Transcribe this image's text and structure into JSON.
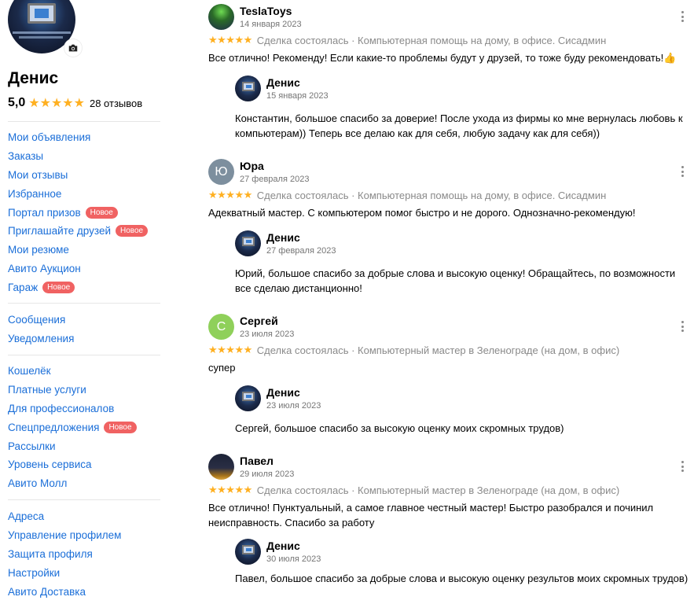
{
  "profile": {
    "name": "Денис",
    "rating": "5,0",
    "stars": "★★★★★",
    "reviews_count": "28 отзывов",
    "camera_icon": "camera-icon"
  },
  "menu_groups": [
    [
      {
        "label": "Мои объявления"
      },
      {
        "label": "Заказы"
      },
      {
        "label": "Мои отзывы"
      },
      {
        "label": "Избранное"
      },
      {
        "label": "Портал призов",
        "badge": "Новое"
      },
      {
        "label": "Приглашайте друзей",
        "badge": "Новое"
      },
      {
        "label": "Мои резюме"
      },
      {
        "label": "Авито Аукцион"
      },
      {
        "label": "Гараж",
        "badge": "Новое"
      }
    ],
    [
      {
        "label": "Сообщения"
      },
      {
        "label": "Уведомления"
      }
    ],
    [
      {
        "label": "Кошелёк"
      },
      {
        "label": "Платные услуги"
      },
      {
        "label": "Для профессионалов"
      },
      {
        "label": "Спецпредложения",
        "badge": "Новое"
      },
      {
        "label": "Рассылки"
      },
      {
        "label": "Уровень сервиса"
      },
      {
        "label": "Авито Молл"
      }
    ],
    [
      {
        "label": "Адреса"
      },
      {
        "label": "Управление профилем"
      },
      {
        "label": "Защита профиля"
      },
      {
        "label": "Настройки"
      },
      {
        "label": "Авито Доставка"
      }
    ]
  ],
  "colors": {
    "link": "#1a6ed8",
    "star": "#ffb021",
    "badge": "#f06262",
    "muted": "#8a8a8a"
  },
  "reviews": [
    {
      "author": "TeslaToys",
      "avatar_letter": "",
      "date": "14 января 2023",
      "stars": "★★★★★",
      "deal": "Сделка состоялась · Компьютерная помощь на дому, в офисе. Сисадмин",
      "text": "Все отлично! Рекоменду! Если какие-то проблемы будут у друзей, то тоже буду рекомендовать!👍",
      "reply": {
        "author": "Денис",
        "date": "15 января 2023",
        "text": "Константин, большое спасибо за доверие! После ухода из фирмы ко мне вернулась любовь к компьютерам)) Теперь все делаю как для себя, любую задачу как для себя))"
      }
    },
    {
      "author": "Юра",
      "avatar_letter": "Ю",
      "date": "27 февраля 2023",
      "stars": "★★★★★",
      "deal": "Сделка состоялась · Компьютерная помощь на дому, в офисе. Сисадмин",
      "text": "Адекватный мастер. С компьютером помог быстро и не дорого. Однозначно-рекомендую!",
      "reply": {
        "author": "Денис",
        "date": "27 февраля 2023",
        "text": "Юрий, большое спасибо за добрые слова и высокую оценку! Обращайтесь, по возможности все сделаю дистанционно!"
      }
    },
    {
      "author": "Сергей",
      "avatar_letter": "С",
      "date": "23 июля 2023",
      "stars": "★★★★★",
      "deal": "Сделка состоялась · Компьютерный мастер в Зеленограде (на дом, в офис)",
      "text": "супер",
      "reply": {
        "author": "Денис",
        "date": "23 июля 2023",
        "text": "Сергей, большое спасибо за высокую оценку моих скромных трудов)"
      }
    },
    {
      "author": "Павел",
      "avatar_letter": "",
      "date": "29 июля 2023",
      "stars": "★★★★★",
      "deal": "Сделка состоялась · Компьютерный мастер в Зеленограде (на дом, в офис)",
      "text": "Все отлично! Пунктуальный, а самое главное честный мастер! Быстро разобрался и починил неисправность. Спасибо за работу",
      "reply": {
        "author": "Денис",
        "date": "30 июля 2023",
        "text": "Павел, большое спасибо за добрые слова и высокую оценку результов моих скромных трудов)"
      }
    }
  ]
}
